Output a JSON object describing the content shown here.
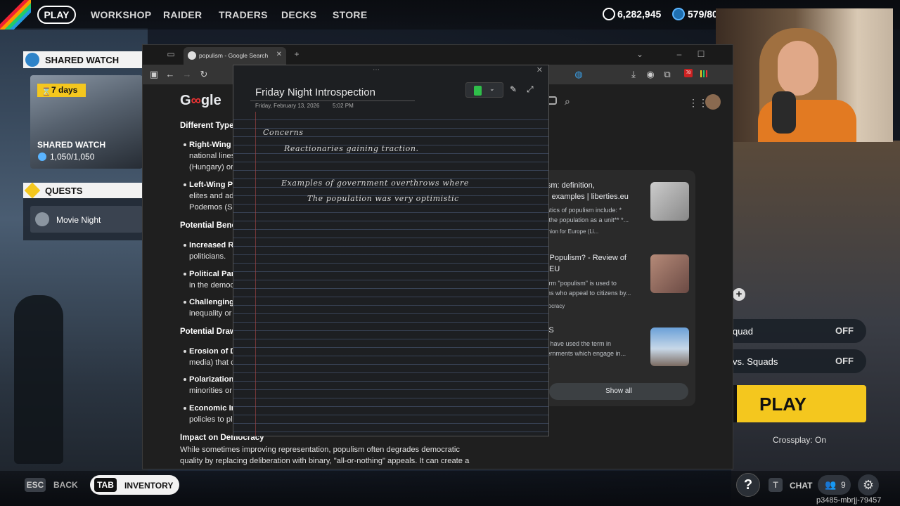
{
  "nav": {
    "play": "PLAY",
    "items": [
      "WORKSHOP",
      "RAIDER",
      "TRADERS",
      "DECKS",
      "STORE"
    ],
    "coins": "6,282,945",
    "tokens": "579/80"
  },
  "shared_watch": {
    "header": "SHARED WATCH",
    "badge": "7  days",
    "card_title": "SHARED WATCH",
    "card_value": "1,050/1,050"
  },
  "quests": {
    "header": "QUESTS",
    "items": [
      "Movie Night"
    ]
  },
  "game_options": [
    {
      "label": "quad",
      "value": "OFF"
    },
    {
      "label": "vs. Squads",
      "value": "OFF"
    }
  ],
  "play_button": "PLAY",
  "crossplay": "Crossplay: On",
  "bottom": {
    "esc_key": "ESC",
    "back": "BACK",
    "tab_key": "TAB",
    "inventory": "INVENTORY",
    "help": "?",
    "t_key": "T",
    "chat": "CHAT",
    "friends": "9",
    "session": "p3485-mbrjj-79457"
  },
  "browser": {
    "tab_title": "populism - Google Search",
    "logo_a": "G",
    "logo_b": "gle",
    "article": {
      "heading1": "Different Type",
      "b1_title": "Right-Wing",
      "b1_text1": "national lines",
      "b1_text2": "(Hungary) or",
      "b2_title": "Left-Wing P",
      "b2_text1": "elites and ad",
      "b2_text2": "Podemos (Sp",
      "heading2": "Potential Bene",
      "b3_title": "Increased R",
      "b3_text1": "politicians.",
      "b4_title": "Political Par",
      "b4_text1": "in the democ",
      "b5_title": "Challenging",
      "b5_text1": "inequality or",
      "heading3": "Potential Draw",
      "b6_title": "Erosion of D",
      "b6_text1": "media) that c",
      "b7_title": "Polarization",
      "b7_text1": "minorities or",
      "b8_title": "Economic Ir",
      "b8_text1": "policies to pl",
      "heading4": "Impact on Democracy",
      "para1": "While sometimes improving representation, populism often degrades democratic",
      "para2": "quality by replacing deliberation with binary, \"all-or-nothing\" appeals. It can create a"
    },
    "results": [
      {
        "title1": "lism: definition,",
        "title2": "s, examples | liberties.eu",
        "snip1": "ristics of populism include: *",
        "snip2": "e the population as a unit** *...",
        "src": "Union for Europe (Li..."
      },
      {
        "title1": "s Populism? - Review of",
        "title2": "CEU",
        "snip1": "term \"populism\" is used to",
        "snip2": "ans who appeal to citizens by...",
        "src": "mocracy"
      },
      {
        "title1": "PS",
        "title2": "",
        "snip1": "ts have used the term in",
        "snip2": "vernments which engage in...",
        "src": "es"
      }
    ],
    "show_all": "Show all"
  },
  "note": {
    "title": "Friday Night Introspection",
    "date": "Friday, February 13, 2026",
    "time": "5:02 PM",
    "handwriting": {
      "line1": "Concerns",
      "line2": "Reactionaries gaining traction.",
      "line3": "Examples of government overthrows where",
      "line4": "The population was very optimistic"
    }
  },
  "colors": {
    "accent_yellow": "#f4c71e",
    "accent_blue": "#2e83c8",
    "notebook_green": "#2fbf4a"
  }
}
